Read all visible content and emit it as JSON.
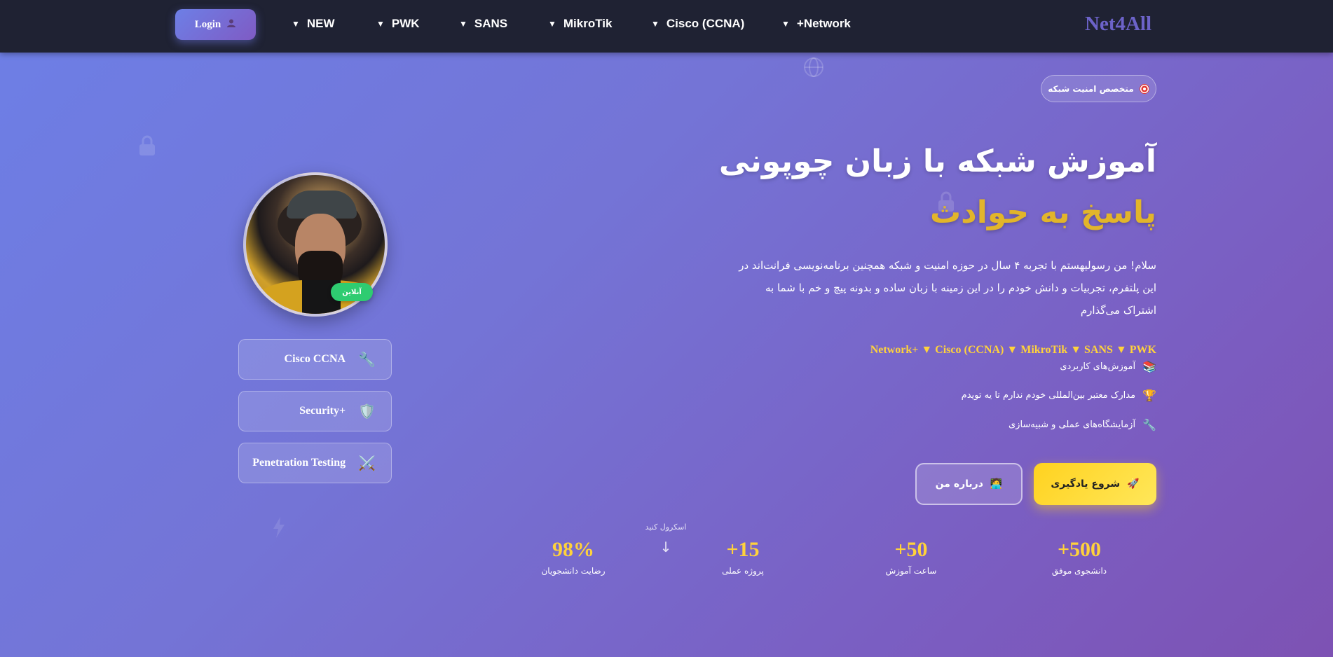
{
  "nav": {
    "login_label": "Login",
    "login_icon": "user-icon",
    "items": [
      "NEW",
      "PWK",
      "SANS",
      "MikroTik",
      "Cisco (CCNA)",
      "+Network"
    ],
    "brand": "Net4All"
  },
  "hero": {
    "badge": "متخصص امنیت شبکه",
    "badge_icon": "target-icon",
    "title_line1": "آموزش شبکه با زبان چوپونی",
    "title_line2": "پاسخ به حوادث",
    "intro": "سلام! من رسولیهستم با تجربه ۴ سال در حوزه امنیت و شبکه همچنین برنامه‌نویسی فرانت‌اند در این پلتفرم، تجربیات و دانش خودم را در این زمینه با زبان ساده و بدونه پیچ و خم با شما به اشتراک می‌گذارم",
    "tags": "Network+ ▼ Cisco (CCNA) ▼ MikroTik ▼ SANS ▼ PWK",
    "features": [
      {
        "icon": "books-icon",
        "text": "آموزش‌های کاربردی"
      },
      {
        "icon": "trophy-icon",
        "text": "مدارک معتبر بین‌المللی خودم ندارم تا یه تویدم"
      },
      {
        "icon": "wrench-icon",
        "text": "آزمایشگاه‌های عملی و شبیه‌سازی"
      }
    ],
    "start_button": "شروع یادگیری",
    "about_button": "درباره من",
    "scroll_hint": "اسکرول کنید",
    "scroll_arrow": "↓"
  },
  "stats": [
    {
      "value": "+500",
      "label": "دانشجوی موفق"
    },
    {
      "value": "+50",
      "label": "ساعت آموزش"
    },
    {
      "value": "+15",
      "label": "پروژه عملی"
    },
    {
      "value": "98%",
      "label": "رضایت دانشجویان"
    }
  ],
  "profile": {
    "online_label": "آنلاین",
    "skills": [
      {
        "icon": "wrench-icon",
        "label": "Cisco CCNA"
      },
      {
        "icon": "shield-icon",
        "label": "Security+"
      },
      {
        "icon": "swords-icon",
        "label": "Penetration Testing"
      }
    ]
  },
  "colors": {
    "accent_yellow": "#ffd23b",
    "title_gold": "#e2b52a",
    "navbar_bg": "#1f2233",
    "brand": "#6c63c9",
    "online_green": "#2ecc71"
  }
}
